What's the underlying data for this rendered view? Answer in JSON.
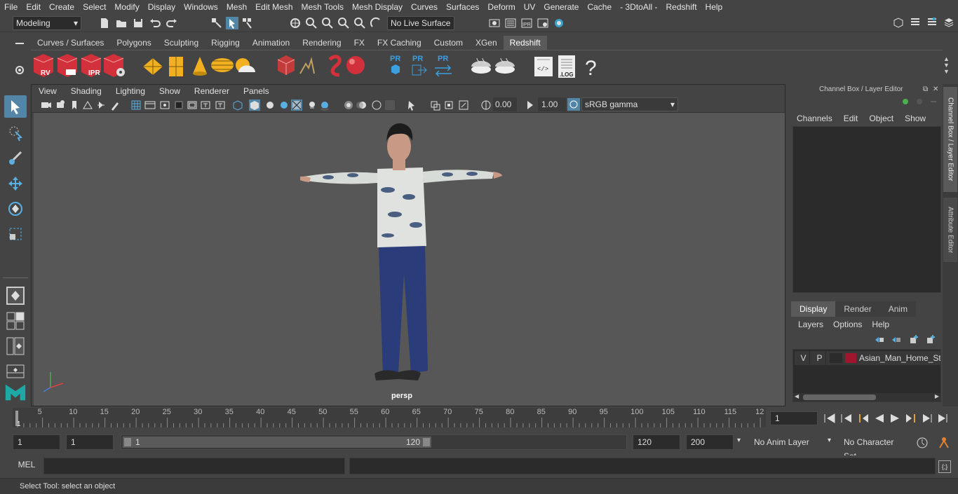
{
  "menubar": {
    "items": [
      "File",
      "Edit",
      "Create",
      "Select",
      "Modify",
      "Display",
      "Windows",
      "Mesh",
      "Edit Mesh",
      "Mesh Tools",
      "Mesh Display",
      "Curves",
      "Surfaces",
      "Deform",
      "UV",
      "Generate",
      "Cache",
      "- 3DtoAll -",
      "Redshift",
      "Help"
    ]
  },
  "toolrow": {
    "mode_select": "Modeling",
    "live_surface": "No Live Surface"
  },
  "shelf": {
    "tabs": [
      "Curves / Surfaces",
      "Polygons",
      "Sculpting",
      "Rigging",
      "Animation",
      "Rendering",
      "FX",
      "FX Caching",
      "Custom",
      "XGen",
      "Redshift"
    ],
    "active_tab": "Redshift",
    "icons": [
      "RV",
      "IPR"
    ],
    "pr_labels": [
      "PR",
      "PR",
      "PR"
    ],
    "log_label": ".LOG",
    "help_label": "?"
  },
  "viewport": {
    "menu": [
      "View",
      "Shading",
      "Lighting",
      "Show",
      "Renderer",
      "Panels"
    ],
    "exposure": "0.00",
    "gamma": "1.00",
    "color_space": "sRGB gamma",
    "camera_label": "persp"
  },
  "rightpanel": {
    "title": "Channel Box / Layer Editor",
    "menu": [
      "Channels",
      "Edit",
      "Object",
      "Show"
    ],
    "layer_tabs": [
      "Display",
      "Render",
      "Anim"
    ],
    "layer_menu": [
      "Layers",
      "Options",
      "Help"
    ],
    "layer_v": "V",
    "layer_p": "P",
    "layer_name": "Asian_Man_Home_Styl",
    "layer_color": "#a0162e"
  },
  "sidetabs": {
    "channel_box": "Channel Box / Layer Editor",
    "attribute_editor": "Attribute Editor"
  },
  "timeline": {
    "ticks": [
      "5",
      "10",
      "15",
      "20",
      "25",
      "30",
      "35",
      "40",
      "45",
      "50",
      "55",
      "60",
      "65",
      "70",
      "75",
      "80",
      "85",
      "90",
      "95",
      "100",
      "105",
      "110",
      "115",
      "12"
    ],
    "start_marker": "1",
    "current_frame": "1"
  },
  "range": {
    "start": "1",
    "playback_start": "1",
    "slider_start": "1",
    "slider_end": "120",
    "playback_end": "120",
    "end": "200",
    "anim_layer": "No Anim Layer",
    "character_set": "No Character Set"
  },
  "mel": {
    "label": "MEL"
  },
  "status": {
    "text": "Select Tool: select an object"
  },
  "colors": {
    "accent": "#5285a6",
    "bg": "#444444",
    "viewport_bg": "#575757",
    "shelf_red": "#d2303a"
  }
}
